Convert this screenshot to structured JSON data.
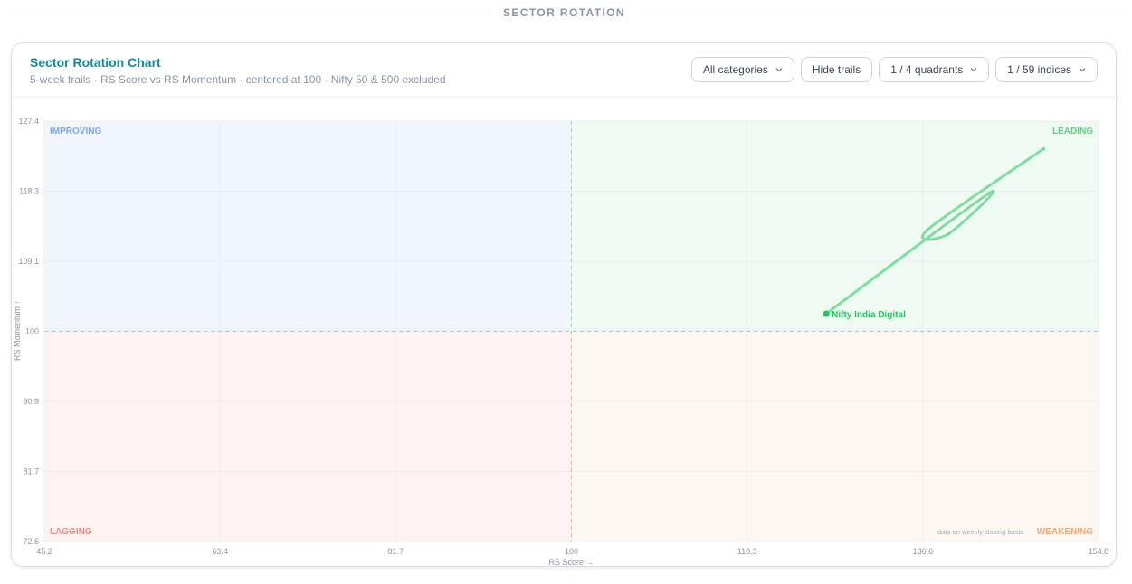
{
  "section": {
    "label": "SECTOR ROTATION"
  },
  "card": {
    "title": "Sector Rotation Chart",
    "subtitle": "5-week trails · RS Score vs RS Momentum · centered at 100 · Nifty 50 & 500 excluded"
  },
  "controls": {
    "categories": "All categories",
    "trails": "Hide trails",
    "quadrants": "1 / 4 quadrants",
    "indices": "1 / 59 indices"
  },
  "chart_data": {
    "type": "scatter",
    "xlabel": "RS Score →",
    "ylabel": "RS Momentum ↑",
    "xlim": [
      45.2,
      154.8
    ],
    "ylim": [
      72.6,
      127.4
    ],
    "xticks": [
      "45.2",
      "63.4",
      "81.7",
      "100",
      "118.3",
      "136.6",
      "154.8"
    ],
    "yticks": [
      "127.4",
      "118.3",
      "109.1",
      "100",
      "90.9",
      "81.7",
      "72.6"
    ],
    "center": [
      100,
      100
    ],
    "quadrants": {
      "improving": "IMPROVING",
      "leading": "LEADING",
      "lagging": "LAGGING",
      "weakening": "WEAKENING"
    },
    "note": "data on weekly closing basis",
    "colors": {
      "improving_bg": "#f1f6fd",
      "leading_bg": "#effaf3",
      "lagging_bg": "#fdf3f3",
      "weakening_bg": "#fdf7f2",
      "improving_text": "#7aa7e6",
      "leading_text": "#5dcd86",
      "lagging_text": "#ee8a8a",
      "weakening_text": "#f3a772",
      "series": "#22c55e"
    },
    "series": [
      {
        "name": "Nifty India Digital",
        "x": [
          149.1,
          137.0,
          139.2,
          143.4,
          126.5
        ],
        "y": [
          123.8,
          113.2,
          112.7,
          118.0,
          102.3
        ]
      }
    ]
  }
}
